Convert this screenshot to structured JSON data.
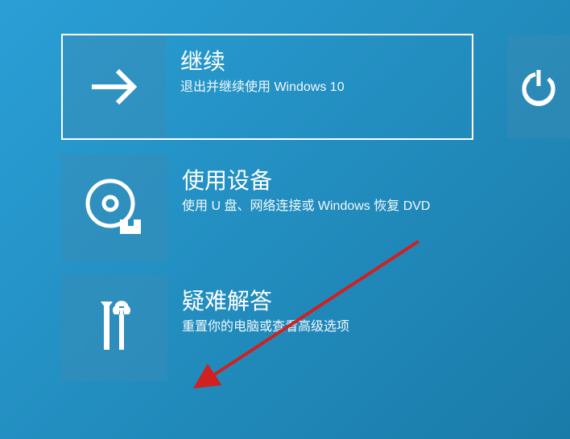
{
  "options": [
    {
      "title": "继续",
      "subtitle": "退出并继续使用 Windows 10"
    },
    {
      "title": "使用设备",
      "subtitle": "使用 U 盘、网络连接或 Windows 恢复 DVD"
    },
    {
      "title": "疑难解答",
      "subtitle": "重置你的电脑或查看高级选项"
    }
  ]
}
